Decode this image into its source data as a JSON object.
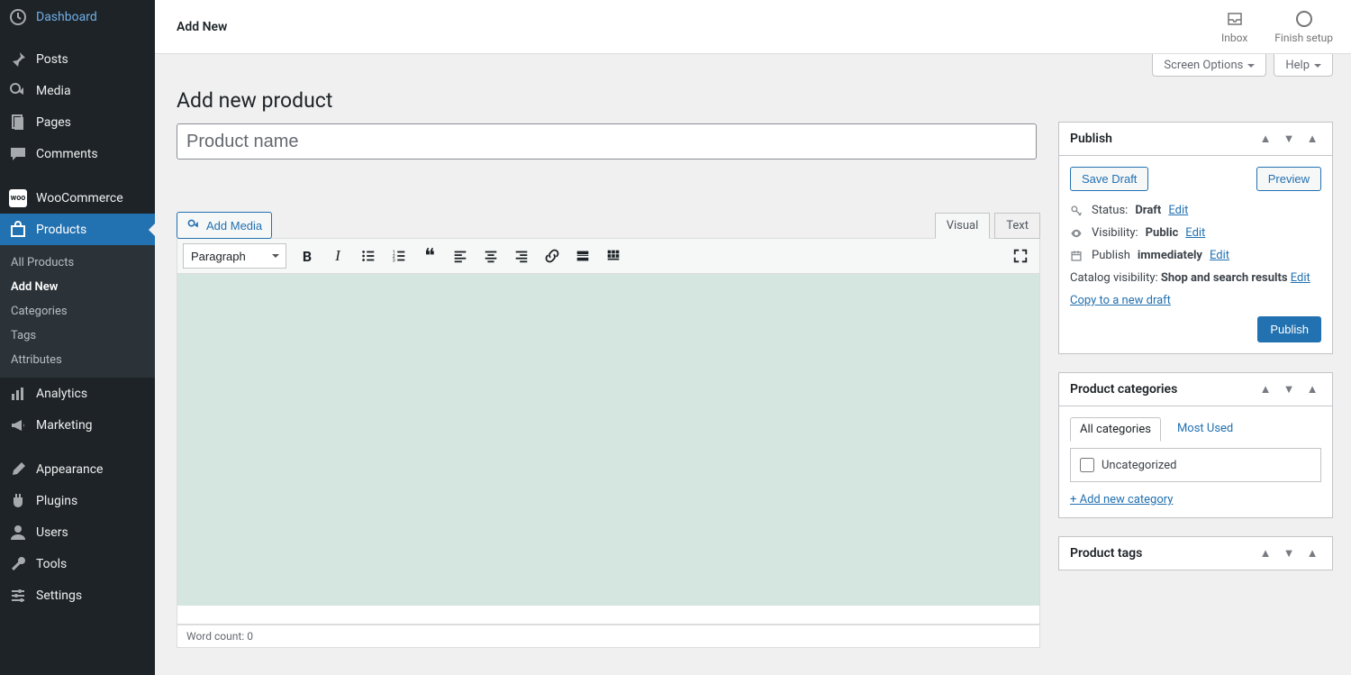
{
  "sidebar": {
    "dashboard": "Dashboard",
    "posts": "Posts",
    "media": "Media",
    "pages": "Pages",
    "comments": "Comments",
    "woocommerce": "WooCommerce",
    "products": "Products",
    "analytics": "Analytics",
    "marketing": "Marketing",
    "appearance": "Appearance",
    "plugins": "Plugins",
    "users": "Users",
    "tools": "Tools",
    "settings": "Settings",
    "sub": {
      "all": "All Products",
      "add": "Add New",
      "categories": "Categories",
      "tags": "Tags",
      "attributes": "Attributes"
    }
  },
  "topbar": {
    "title": "Add New",
    "inbox": "Inbox",
    "finish": "Finish setup"
  },
  "screen_options": "Screen Options",
  "help": "Help",
  "page_title": "Add new product",
  "title_placeholder": "Product name",
  "editor": {
    "add_media": "Add Media",
    "visual": "Visual",
    "text": "Text",
    "format": "Paragraph",
    "wordcount_label": "Word count:",
    "wordcount_value": "0"
  },
  "publish": {
    "title": "Publish",
    "save_draft": "Save Draft",
    "preview": "Preview",
    "status_label": "Status:",
    "status_value": "Draft",
    "visibility_label": "Visibility:",
    "visibility_value": "Public",
    "publish_label": "Publish",
    "publish_value": "immediately",
    "catalog_label": "Catalog visibility:",
    "catalog_value": "Shop and search results",
    "edit": "Edit",
    "copy": "Copy to a new draft",
    "publish_btn": "Publish"
  },
  "categories": {
    "title": "Product categories",
    "all_tab": "All categories",
    "mostused_tab": "Most Used",
    "uncategorized": "Uncategorized",
    "add_new": "+ Add new category"
  },
  "tags_box": {
    "title": "Product tags"
  }
}
